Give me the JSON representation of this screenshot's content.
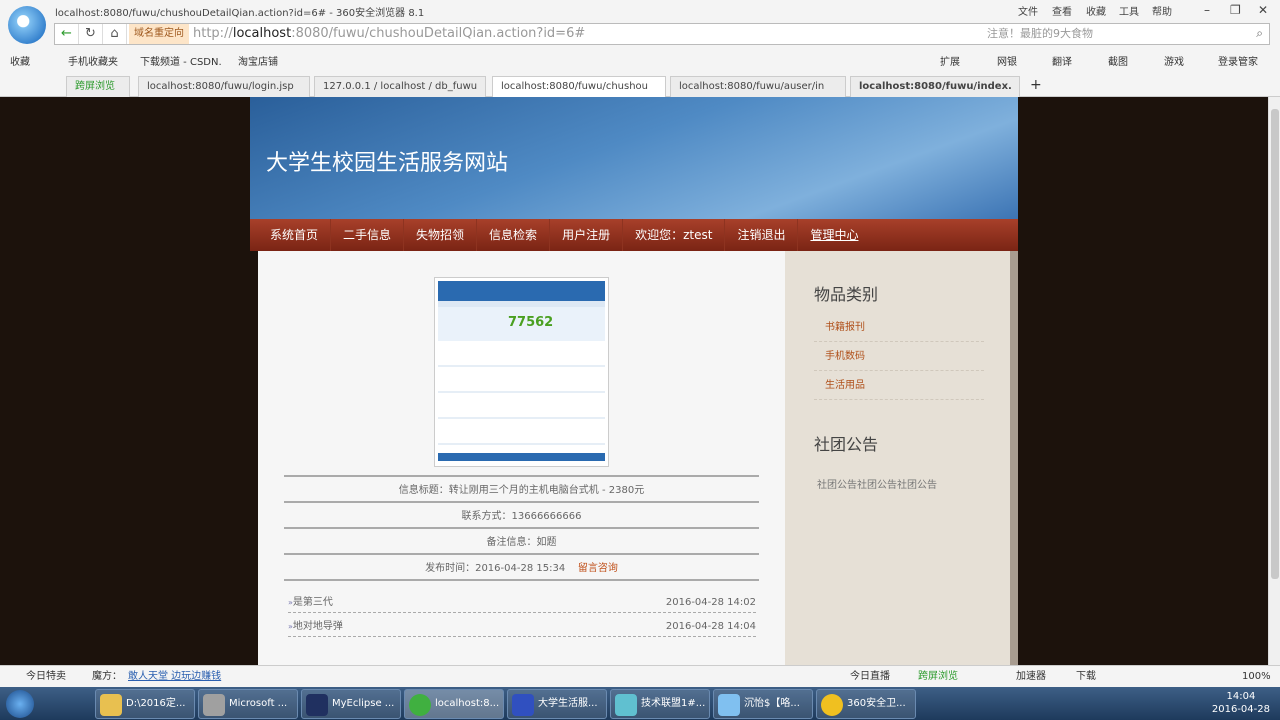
{
  "browser": {
    "window_title": "localhost:8080/fuwu/chushouDetailQian.action?id=6# - 360安全浏览器 8.1",
    "menu": [
      "文件",
      "查看",
      "收藏",
      "工具",
      "帮助"
    ],
    "redirect_label": "域名重定向",
    "url_prefix": "http://",
    "url_host": "localhost",
    "url_rest": ":8080/fuwu/chushouDetailQian.action?id=6#",
    "search_placeholder": "注意！最脏的9大食物",
    "bookmarks": [
      "收藏",
      "手机收藏夹",
      "下载频道 - CSDN.",
      "淘宝店铺"
    ],
    "toolbar_right": [
      "扩展",
      "网银",
      "翻译",
      "截图",
      "游戏",
      "登录管家"
    ],
    "split_view": "跨屏浏览",
    "tabs": [
      {
        "label": "localhost:8080/fuwu/login.jsp",
        "active": false
      },
      {
        "label": "127.0.0.1 / localhost / db_fuwu",
        "active": false
      },
      {
        "label": "localhost:8080/fuwu/chushou",
        "active": true
      },
      {
        "label": "localhost:8080/fuwu/auser/in",
        "active": false
      },
      {
        "label": "localhost:8080/fuwu/index.",
        "active": false
      }
    ]
  },
  "site": {
    "title": "大学生校园生活服务网站",
    "nav": [
      "系统首页",
      "二手信息",
      "失物招领",
      "信息检索",
      "用户注册",
      "欢迎您：ztest",
      "注销退出",
      "管理中心"
    ],
    "detail": {
      "title": "信息标题：转让刚用三个月的主机电脑台式机 - 2380元",
      "contact": "联系方式：13666666666",
      "note": "备注信息：如题",
      "time": "发布时间：2016-04-28 15:34",
      "consult": "留言咨询",
      "image_number": "77562"
    },
    "comments": [
      {
        "text": "是第三代",
        "date": "2016-04-28 14:02"
      },
      {
        "text": "地对地导弹",
        "date": "2016-04-28 14:04"
      }
    ],
    "sidebar": {
      "cat_heading": "物品类别",
      "categories": [
        "书籍报刊",
        "手机数码",
        "生活用品"
      ],
      "notice_heading": "社团公告",
      "notice": "社团公告社团公告社团公告"
    }
  },
  "statusbar": {
    "left": [
      "今日特卖",
      "魔方：",
      "敢人天堂 边玩边赚钱"
    ],
    "right": [
      "今日直播",
      "跨屏浏览",
      "加速器",
      "下载"
    ],
    "zoom": "100%"
  },
  "taskbar": {
    "items": [
      "D:\\2016定...",
      "Microsoft ...",
      "MyEclipse ...",
      "localhost:8...",
      "大学生活服...",
      "技术联盟1#...",
      "沉怡$【咯...",
      "360安全卫..."
    ],
    "time": "14:04",
    "date": "2016-04-28"
  }
}
